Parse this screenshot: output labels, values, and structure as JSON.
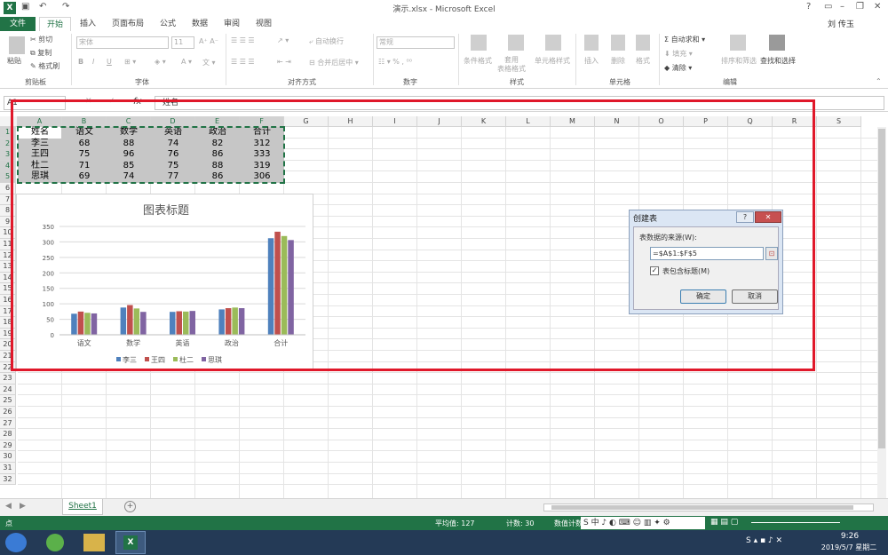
{
  "titlebar": {
    "title": "演示.xlsx - Microsoft Excel",
    "user": "刘 传玉"
  },
  "menus": [
    "文件",
    "开始",
    "插入",
    "页面布局",
    "公式",
    "数据",
    "审阅",
    "视图"
  ],
  "ribbon": {
    "clipboard": {
      "paste": "粘贴",
      "cut": "剪切",
      "copy": "复制",
      "painter": "格式刷",
      "label": "剪贴板"
    },
    "font": {
      "name": "宋体",
      "size": "11",
      "bold": "B",
      "italic": "I",
      "underline": "U",
      "label": "字体"
    },
    "align": {
      "wrap": "自动换行",
      "merge": "合并后居中",
      "label": "对齐方式"
    },
    "number": {
      "format": "常规",
      "label": "数字"
    },
    "styles": {
      "cond": "条件格式",
      "table": "套用\n表格格式",
      "cellstyle": "单元格样式",
      "label": "样式"
    },
    "cells": {
      "insert": "插入",
      "delete": "删除",
      "format": "格式",
      "label": "单元格"
    },
    "editing": {
      "autosum": "自动求和",
      "fill": "填充",
      "clear": "清除",
      "sort": "排序和筛选",
      "find": "查找和选择",
      "label": "编辑"
    }
  },
  "formula": {
    "namebox": "A1",
    "fx": "fx",
    "value": "姓名"
  },
  "columns": [
    "A",
    "B",
    "C",
    "D",
    "E",
    "F",
    "G",
    "H",
    "I",
    "J",
    "K",
    "L",
    "M",
    "N",
    "O",
    "P",
    "Q",
    "R",
    "S"
  ],
  "rows": [
    "1",
    "2",
    "3",
    "4",
    "5",
    "6",
    "7",
    "8",
    "9",
    "10",
    "11",
    "12",
    "13",
    "14",
    "15",
    "16",
    "17",
    "18",
    "19",
    "20",
    "21",
    "22",
    "23",
    "24",
    "25",
    "26",
    "27",
    "28",
    "29",
    "30",
    "31",
    "32"
  ],
  "table": {
    "header": [
      "姓名",
      "语文",
      "数学",
      "英语",
      "政治",
      "合计"
    ],
    "rows": [
      [
        "李三",
        "68",
        "88",
        "74",
        "82",
        "312"
      ],
      [
        "王四",
        "75",
        "96",
        "76",
        "86",
        "333"
      ],
      [
        "杜二",
        "71",
        "85",
        "75",
        "88",
        "319"
      ],
      [
        "思琪",
        "69",
        "74",
        "77",
        "86",
        "306"
      ]
    ]
  },
  "chart_data": {
    "type": "bar",
    "title": "图表标题",
    "categories": [
      "语文",
      "数学",
      "英语",
      "政治",
      "合计"
    ],
    "series": [
      {
        "name": "李三",
        "values": [
          68,
          88,
          74,
          82,
          312
        ],
        "color": "#4f81bd"
      },
      {
        "name": "王四",
        "values": [
          75,
          96,
          76,
          86,
          333
        ],
        "color": "#c0504d"
      },
      {
        "name": "杜二",
        "values": [
          71,
          85,
          75,
          88,
          319
        ],
        "color": "#9bbb59"
      },
      {
        "name": "思琪",
        "values": [
          69,
          74,
          77,
          86,
          306
        ],
        "color": "#8064a2"
      }
    ],
    "yticks": [
      "0",
      "50",
      "100",
      "150",
      "200",
      "250",
      "300",
      "350"
    ],
    "ylim": [
      0,
      350
    ],
    "grid": true,
    "legend": "bottom"
  },
  "dialog": {
    "title": "创建表",
    "help": "?",
    "close": "✕",
    "range_label": "表数据的来源(W):",
    "range_value": "=$A$1:$F$5",
    "has_header": "表包含标题(M)",
    "ok": "确定",
    "cancel": "取消"
  },
  "sheet": {
    "tab": "Sheet1",
    "add": "+"
  },
  "status": {
    "ready": "点",
    "avg": "平均值: 127",
    "count": "计数: 30",
    "numcount": "数值计数"
  },
  "taskbar": {
    "time": "9:26",
    "date": "2019/5/7 星期二"
  },
  "colors": {
    "excel_green": "#217346",
    "highlight": "#e0182a"
  }
}
